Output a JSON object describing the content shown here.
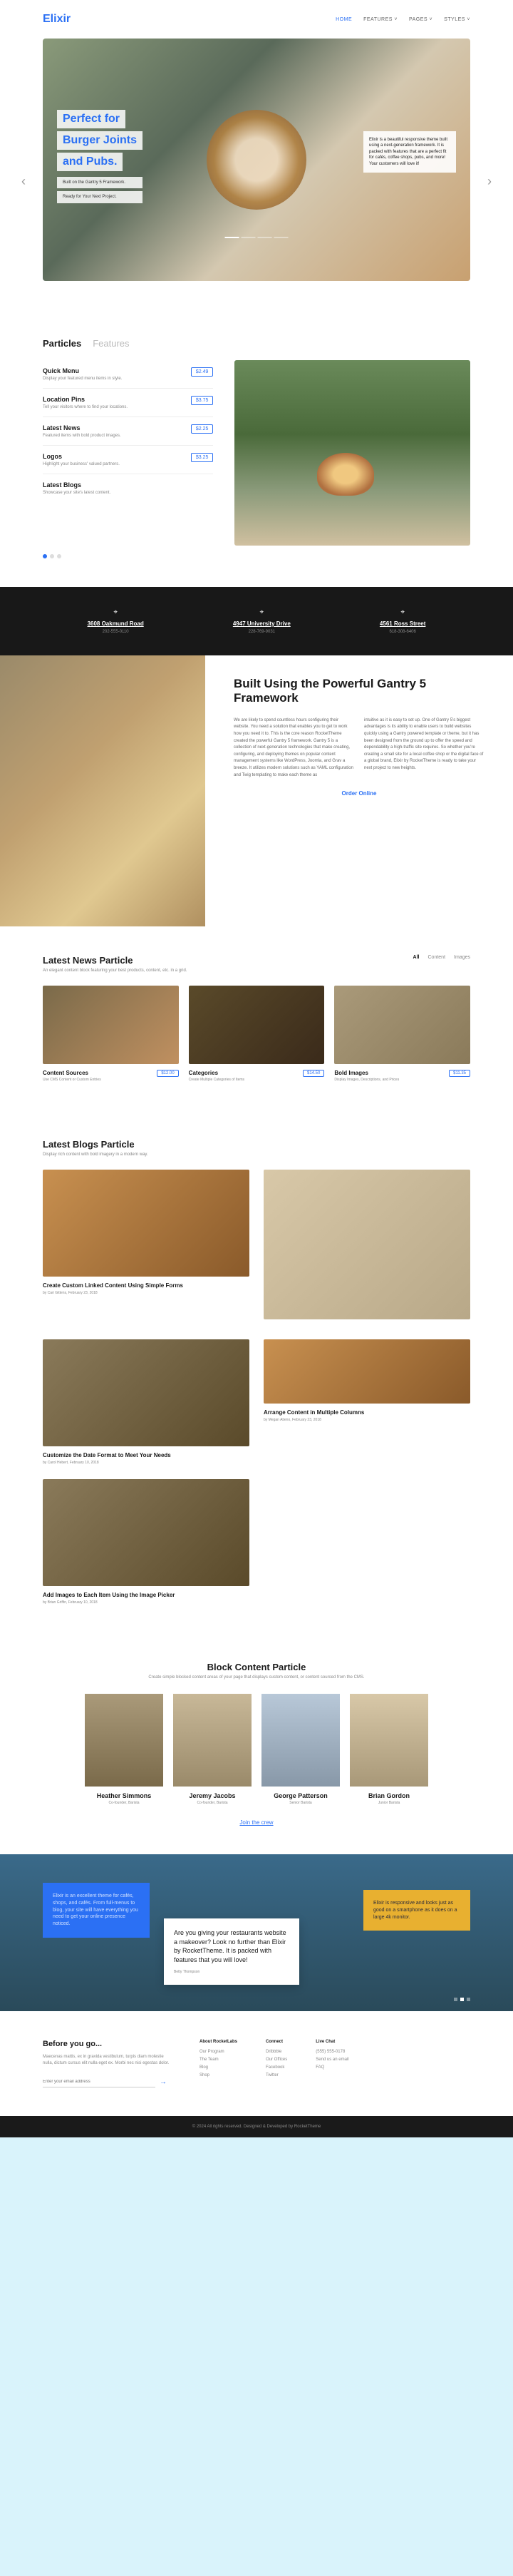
{
  "brand": "Elixir",
  "nav": {
    "home": "HOME",
    "features": "FEATURES ˅",
    "pages": "PAGES ˅",
    "styles": "STYLES ˅"
  },
  "hero": {
    "title1": "Perfect for",
    "title2": "Burger Joints",
    "title3": "and Pubs.",
    "sub1": "Built on the Gantry 5 Framework.",
    "sub2": "Ready for Your Next Project.",
    "right": "Elixir is a beautiful responsive theme built using a next-generation framework. It is packed with features that are a perfect fit for cafés, coffee shops, pubs, and more! Your customers will love it!"
  },
  "particles": {
    "tab1": "Particles",
    "tab2": "Features",
    "items": [
      {
        "name": "Quick Menu",
        "desc": "Display your featured menu items in style.",
        "price": "$2.49"
      },
      {
        "name": "Location Pins",
        "desc": "Tell your visitors where to find your locations.",
        "price": "$3.75"
      },
      {
        "name": "Latest News",
        "desc": "Featured items with bold product images.",
        "price": "$2.25"
      },
      {
        "name": "Logos",
        "desc": "Highlight your business' valued partners.",
        "price": "$3.25"
      },
      {
        "name": "Latest Blogs",
        "desc": "Showcase your site's latest content.",
        "price": ""
      }
    ]
  },
  "locations": [
    {
      "addr": "3608 Oakmund Road",
      "phone": "202-555-0110"
    },
    {
      "addr": "4947 University Drive",
      "phone": "228-769-9031"
    },
    {
      "addr": "4561 Ross Street",
      "phone": "618-308-6406"
    }
  ],
  "built": {
    "title": "Built Using the Powerful Gantry 5 Framework",
    "col1": "We are likely to spend countless hours configuring their website. You need a solution that enables you to get to work how you need it to. This is the core reason RocketTheme created the powerful Gantry 5 framework. Gantry 5 is a collection of next-generation technologies that make creating, configuring, and deploying themes on popular content management systems like WordPress, Joomla, and Grav a breeze. It utilizes modern solutions such as YAML configuration and Twig templating to make each theme as",
    "col2": "intuitive as it is easy to set up. One of Gantry 5's biggest advantages is its ability to enable users to build websites quickly using a Gantry powered template or theme, but it has been designed from the ground up to offer the speed and dependability a high-traffic site requires. So whether you're creating a small site for a local coffee shop or the digital face of a global brand, Elixir by RocketTheme is ready to take your next project to new heights.",
    "order": "Order Online"
  },
  "news": {
    "title": "Latest News Particle",
    "desc": "An elegant content block featuring your best products, content, etc. in a grid.",
    "filters": {
      "all": "All",
      "content": "Content",
      "images": "Images"
    },
    "items": [
      {
        "name": "Content Sources",
        "sub": "Use CMS Content or Custom Entries",
        "price": "$12.00"
      },
      {
        "name": "Categories",
        "sub": "Create Multiple Categories of Items",
        "price": "$14.50"
      },
      {
        "name": "Bold Images",
        "sub": "Display Images, Descriptions, and Prices",
        "price": "$11.35"
      }
    ]
  },
  "blogs": {
    "title": "Latest Blogs Particle",
    "desc": "Display rich content with bold imagery in a modern way.",
    "items": [
      {
        "t": "Create Custom Linked Content Using Simple Forms",
        "by": "by Cari Gittens, February 23, 2018"
      },
      {
        "t": "",
        "by": ""
      },
      {
        "t": "Customize the Date Format to Meet Your Needs",
        "by": "by Carol Hebert, February 10, 2018"
      },
      {
        "t": "Arrange Content in Multiple Columns",
        "by": "by Megan Atieno, February 23, 2018"
      },
      {
        "t": "Add Images to Each Item Using the Image Picker",
        "by": "by Brian Griffin, February 10, 2018"
      }
    ]
  },
  "block": {
    "title": "Block Content Particle",
    "desc": "Create simple blocked content areas of your page that displays custom content, or content sourced from the CMS.",
    "team": [
      {
        "name": "Heather Simmons",
        "role": "Co-founder, Barista"
      },
      {
        "name": "Jeremy Jacobs",
        "role": "Co-founder, Barista"
      },
      {
        "name": "George Patterson",
        "role": "Senior Barista"
      },
      {
        "name": "Brian Gordon",
        "role": "Junior Barista"
      }
    ],
    "join": "Join the crew"
  },
  "testi": {
    "t1": "Elixir is an excellent theme for cafés, shops, and cafés. From full-menus to blog, your site will have everything you need to get your online presence noticed.",
    "t2": "Are you giving your restaurants website a makeover? Look no further than Elixir by RocketTheme. It is packed with features that you will love!",
    "t2auth": "Betty Thompson",
    "t3": "Elixir is responsive and looks just as good on a smartphone as it does on a large 4k monitor."
  },
  "footer": {
    "before": "Before you go...",
    "beforetext": "Maecenas mattis, ex in gravida vestibulum, turpis diam molestie nulla, dictum cursus elit nulla eget ex. Morbi nec nisi egestas dolor.",
    "placeholder": "Enter your email address",
    "cols": [
      {
        "h": "About RocketLabs",
        "items": [
          "Our Program",
          "The Team",
          "Blog",
          "Shop"
        ]
      },
      {
        "h": "Connect",
        "items": [
          "Dribbble",
          "Our Offices",
          "Facebook",
          "Twitter"
        ]
      },
      {
        "h": "Live Chat",
        "items": [
          "(555) 555-0178",
          "Send us an email",
          "FAQ"
        ]
      }
    ]
  },
  "copyright": "© 2024 All rights reserved. Designed & Developed by RocketTheme"
}
